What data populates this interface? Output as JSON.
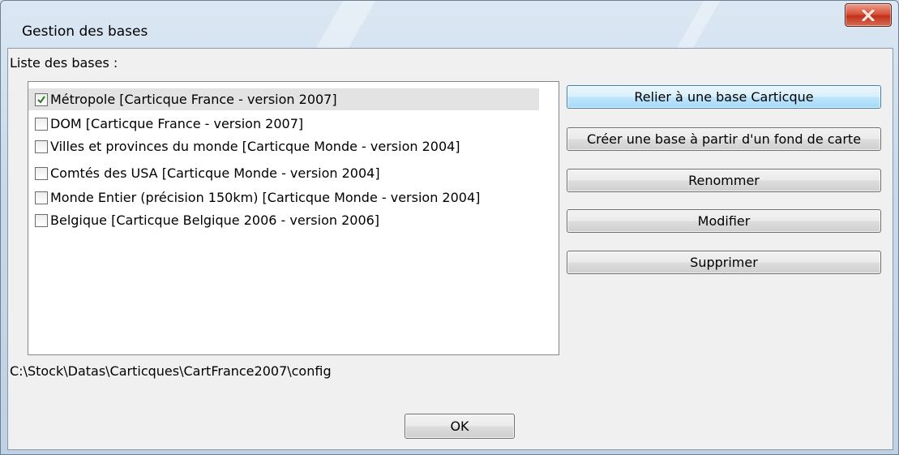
{
  "window": {
    "title": "Gestion des bases",
    "close_label": "X"
  },
  "list": {
    "label": "Liste des bases :",
    "items": [
      {
        "label": "Métropole [Carticque France - version 2007]",
        "checked": true,
        "selected": true
      },
      {
        "label": "DOM [Carticque France - version 2007]",
        "checked": false,
        "selected": false
      },
      {
        "label": "Villes et provinces du monde [Carticque Monde - version 2004]",
        "checked": false,
        "selected": false
      },
      {
        "label": "Comtés des USA [Carticque Monde - version 2004]",
        "checked": false,
        "selected": false
      },
      {
        "label": "Monde Entier (précision 150km) [Carticque Monde - version 2004]",
        "checked": false,
        "selected": false
      },
      {
        "label": "Belgique [Carticque Belgique 2006 - version 2006]",
        "checked": false,
        "selected": false
      }
    ]
  },
  "actions": {
    "link": "Relier à une base Carticque",
    "create": "Créer une base à partir d'un fond de carte",
    "rename": "Renommer",
    "modify": "Modifier",
    "delete": "Supprimer"
  },
  "path": "C:\\Stock\\Datas\\Carticques\\CartFrance2007\\config",
  "ok_label": "OK",
  "colors": {
    "close_button": "#c94a35",
    "default_button": "#bee6fd",
    "selection": "#e3e3e3"
  }
}
